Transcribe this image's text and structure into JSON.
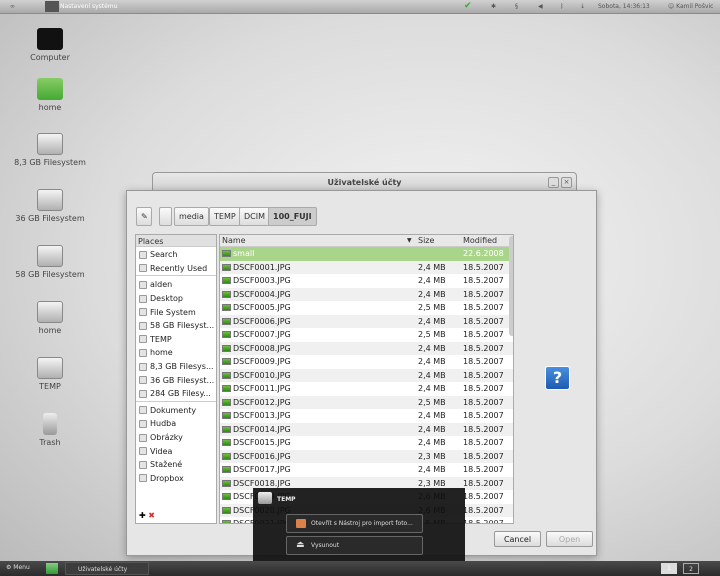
{
  "topbar": {
    "app": "Nastavení systému",
    "clock": "Sobota, 14:36:13",
    "user": "Kamil Pošvic"
  },
  "desktop": [
    {
      "label": "Computer",
      "icon": "monitor-icon"
    },
    {
      "label": "home",
      "icon": "home-folder-icon"
    },
    {
      "label": "8,3 GB Filesystem",
      "icon": "drive-icon"
    },
    {
      "label": "36 GB Filesystem",
      "icon": "drive-icon"
    },
    {
      "label": "58 GB Filesystem",
      "icon": "drive-icon"
    },
    {
      "label": "home",
      "icon": "drive-icon"
    },
    {
      "label": "TEMP",
      "icon": "drive-icon"
    },
    {
      "label": "Trash",
      "icon": "trash-icon"
    }
  ],
  "back_window": {
    "title": "Uživatelské účty"
  },
  "dialog": {
    "path": [
      "media",
      "TEMP",
      "DCIM",
      "100_FUJI"
    ],
    "places_header": "Places",
    "places": [
      "Search",
      "Recently Used",
      "alden",
      "Desktop",
      "File System",
      "58 GB Filesyst...",
      "TEMP",
      "home",
      "8,3 GB Filesys...",
      "36 GB Filesyst...",
      "284 GB Filesy...",
      "Dokumenty",
      "Hudba",
      "Obrázky",
      "Videa",
      "Stažené",
      "Dropbox"
    ],
    "columns": {
      "name": "Name",
      "size": "Size",
      "modified": "Modified"
    },
    "files": [
      {
        "name": "small",
        "size": "",
        "modified": "22.6.2008"
      },
      {
        "name": "DSCF0001.JPG",
        "size": "2,4 MB",
        "modified": "18.5.2007"
      },
      {
        "name": "DSCF0003.JPG",
        "size": "2,4 MB",
        "modified": "18.5.2007"
      },
      {
        "name": "DSCF0004.JPG",
        "size": "2,4 MB",
        "modified": "18.5.2007"
      },
      {
        "name": "DSCF0005.JPG",
        "size": "2,5 MB",
        "modified": "18.5.2007"
      },
      {
        "name": "DSCF0006.JPG",
        "size": "2,4 MB",
        "modified": "18.5.2007"
      },
      {
        "name": "DSCF0007.JPG",
        "size": "2,5 MB",
        "modified": "18.5.2007"
      },
      {
        "name": "DSCF0008.JPG",
        "size": "2,4 MB",
        "modified": "18.5.2007"
      },
      {
        "name": "DSCF0009.JPG",
        "size": "2,4 MB",
        "modified": "18.5.2007"
      },
      {
        "name": "DSCF0010.JPG",
        "size": "2,4 MB",
        "modified": "18.5.2007"
      },
      {
        "name": "DSCF0011.JPG",
        "size": "2,4 MB",
        "modified": "18.5.2007"
      },
      {
        "name": "DSCF0012.JPG",
        "size": "2,5 MB",
        "modified": "18.5.2007"
      },
      {
        "name": "DSCF0013.JPG",
        "size": "2,4 MB",
        "modified": "18.5.2007"
      },
      {
        "name": "DSCF0014.JPG",
        "size": "2,4 MB",
        "modified": "18.5.2007"
      },
      {
        "name": "DSCF0015.JPG",
        "size": "2,4 MB",
        "modified": "18.5.2007"
      },
      {
        "name": "DSCF0016.JPG",
        "size": "2,3 MB",
        "modified": "18.5.2007"
      },
      {
        "name": "DSCF0017.JPG",
        "size": "2,4 MB",
        "modified": "18.5.2007"
      },
      {
        "name": "DSCF0018.JPG",
        "size": "2,3 MB",
        "modified": "18.5.2007"
      },
      {
        "name": "DSCF0019.JPG",
        "size": "2,6 MB",
        "modified": "18.5.2007"
      },
      {
        "name": "DSCF0020.JPG",
        "size": "2,6 MB",
        "modified": "18.5.2007"
      },
      {
        "name": "DSCF0021.JPG",
        "size": "2,5 MB",
        "modified": "18.5.2007"
      }
    ],
    "cancel": "Cancel",
    "open": "Open"
  },
  "popup": {
    "title": "TEMP",
    "open_with": "Otevřít s Nástroj pro import foto...",
    "eject": "Vysunout"
  },
  "taskbar": {
    "menu": "Menu",
    "task": "Uživatelské účty",
    "workspaces": [
      "1",
      "2"
    ]
  }
}
